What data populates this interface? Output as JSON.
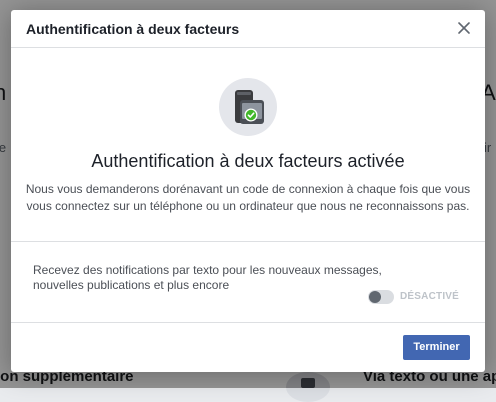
{
  "background": {
    "left_big": "n",
    "right_big": "A",
    "left_small": "le",
    "right_small": "ir",
    "left_small2": "",
    "bottom_left": "ion supplémentaire",
    "bottom_right": "Via texto ou une ap"
  },
  "dialog": {
    "title": "Authentification à deux facteurs",
    "close_icon": "close-icon",
    "hero_icon": "phone-check-icon",
    "heading": "Authentification à deux facteurs activée",
    "description": "Nous vous demanderons dorénavant un code de connexion à chaque fois que vous vous connectez sur un téléphone ou un ordinateur que nous ne reconnaissons pas.",
    "notifications_text": "Recevez des notifications par texto pour les nouveaux messages, nouvelles publications et plus encore",
    "toggle_label": "DÉSACTIVÉ",
    "finish_label": "Terminer"
  },
  "colors": {
    "accent": "#4267b2",
    "success": "#42b72a",
    "overlay": "rgba(0,0,0,0.42)"
  }
}
